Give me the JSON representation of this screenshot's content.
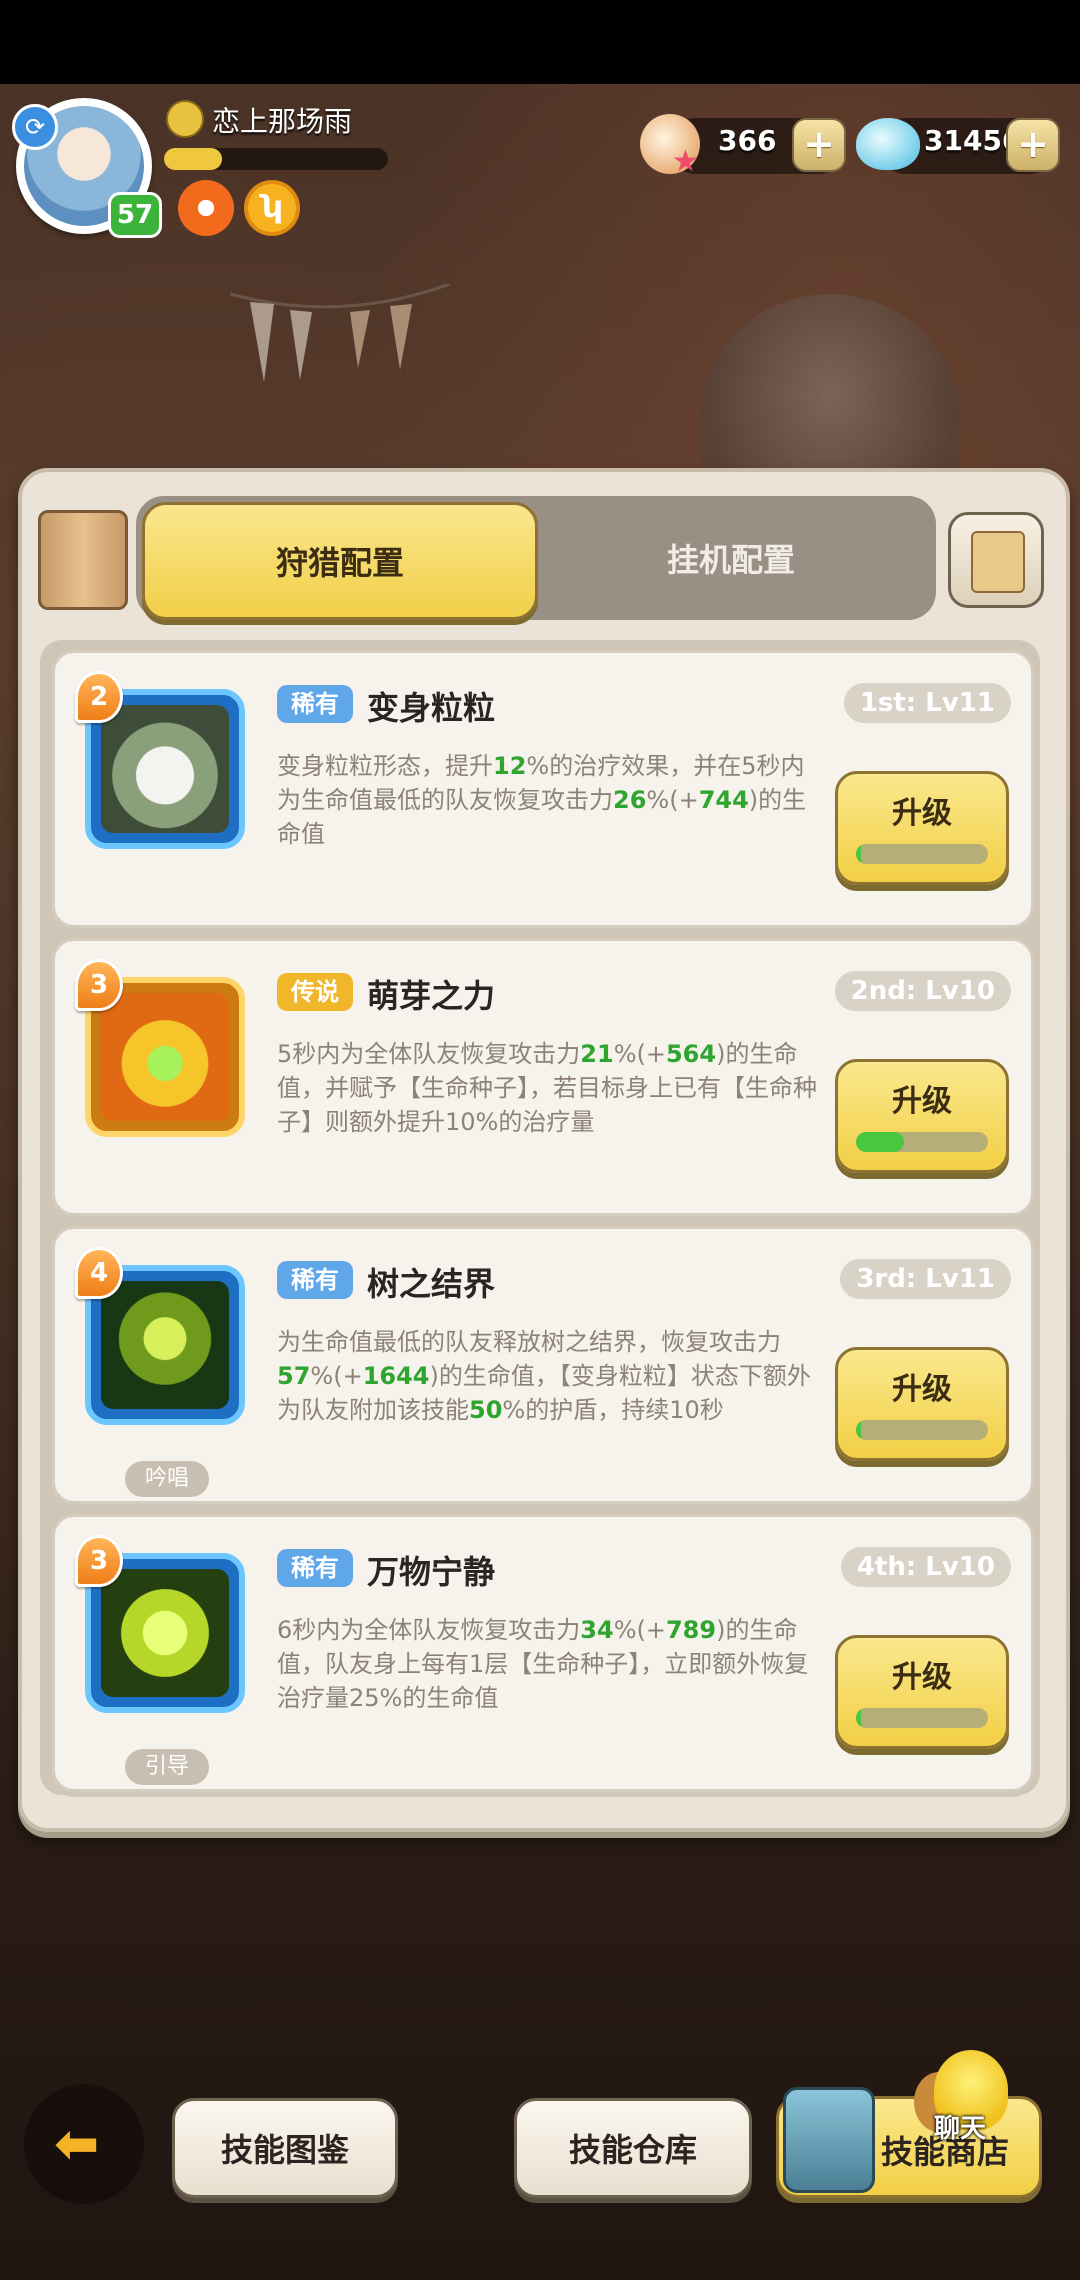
{
  "player": {
    "name": "恋上那场雨",
    "level": "57",
    "xp_fraction": 0.26
  },
  "currency": {
    "pearls": "366",
    "gems": "31456",
    "plus": "+"
  },
  "tabs": {
    "active": "狩猎配置",
    "idle": "挂机配置"
  },
  "upgrade_label": "升级",
  "skills": [
    {
      "cost": "2",
      "rarity": "稀有",
      "name": "变身粒粒",
      "level": "1st: Lv11",
      "desc_parts": [
        "变身粒粒形态，提升",
        "12",
        "%的治疗效果，并在5秒内为生命值最低的队友恢复攻击力",
        "26",
        "%(+",
        "744",
        ")的生命值"
      ],
      "progress": 0.03,
      "tag": ""
    },
    {
      "cost": "3",
      "rarity": "传说",
      "name": "萌芽之力",
      "level": "2nd: Lv10",
      "desc_parts": [
        "5秒内为全体队友恢复攻击力",
        "21",
        "%(+",
        "564",
        ")的生命值，并赋予【生命种子】，若目标身上已有【生命种子】则额外提升10%的治疗量"
      ],
      "progress": 0.36,
      "tag": ""
    },
    {
      "cost": "4",
      "rarity": "稀有",
      "name": "树之结界",
      "level": "3rd: Lv11",
      "desc_parts": [
        "为生命值最低的队友释放树之结界，恢复攻击力",
        "57",
        "%(+",
        "1644",
        ")的生命值，【变身粒粒】状态下额外为队友附加该技能",
        "50",
        "%的护盾，持续10秒"
      ],
      "progress": 0.03,
      "tag": "吟唱"
    },
    {
      "cost": "3",
      "rarity": "稀有",
      "name": "万物宁静",
      "level": "4th: Lv10",
      "desc_parts": [
        "6秒内为全体队友恢复攻击力",
        "34",
        "%(+",
        "789",
        ")的生命值，队友身上每有1层【生命种子】，立即额外恢复治疗量25%的生命值"
      ],
      "progress": 0.03,
      "tag": "引导"
    }
  ],
  "bottom": {
    "codex": "技能图鉴",
    "storage": "技能仓库",
    "shop": "技能商店",
    "chat": "聊天"
  },
  "colors": {
    "highlight": "#2fa52f",
    "rare": "#5fa7e8",
    "legendary": "#f0b72b"
  }
}
